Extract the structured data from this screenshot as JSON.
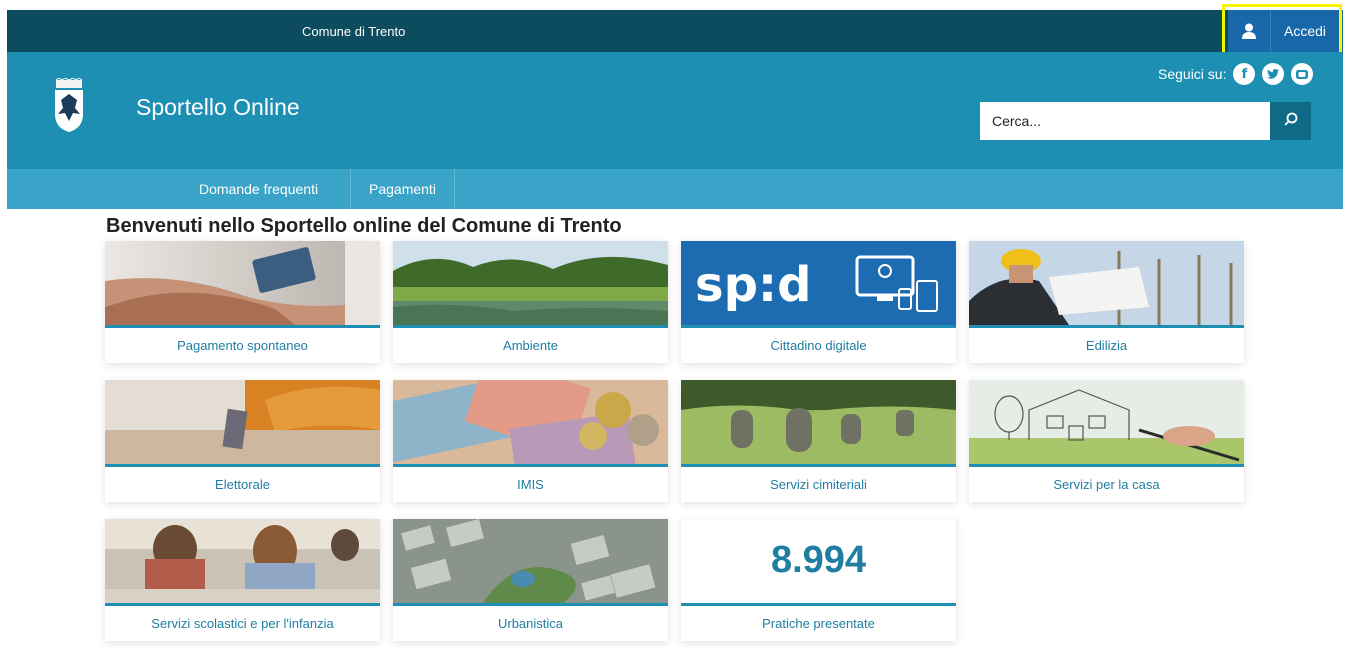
{
  "topbar": {
    "org_name": "Comune di Trento",
    "login_label": "Accedi"
  },
  "header": {
    "site_title": "Sportello Online",
    "social_label": "Seguici su:",
    "social_icons": [
      "facebook-icon",
      "twitter-icon",
      "youtube-icon"
    ],
    "search_placeholder": "Cerca..."
  },
  "nav": {
    "items": [
      "Domande frequenti",
      "Pagamenti"
    ]
  },
  "main": {
    "welcome": "Benvenuti nello Sportello online del Comune di Trento",
    "cards": [
      {
        "label": "Pagamento spontaneo"
      },
      {
        "label": "Ambiente"
      },
      {
        "label": "Cittadino digitale",
        "image_text": "sp:d"
      },
      {
        "label": "Edilizia"
      },
      {
        "label": "Elettorale"
      },
      {
        "label": "IMIS"
      },
      {
        "label": "Servizi cimiteriali"
      },
      {
        "label": "Servizi per la casa"
      },
      {
        "label": "Servizi scolastici e per l'infanzia"
      },
      {
        "label": "Urbanistica"
      }
    ],
    "counter": {
      "value": "8.994",
      "label": "Pratiche presentate"
    }
  },
  "colors": {
    "topbar": "#0c4c5e",
    "header": "#1d8fb3",
    "nav": "#3aa4c8",
    "login": "#1767a9",
    "highlight": "#f5f500",
    "accent_text": "#1f7ea1"
  }
}
